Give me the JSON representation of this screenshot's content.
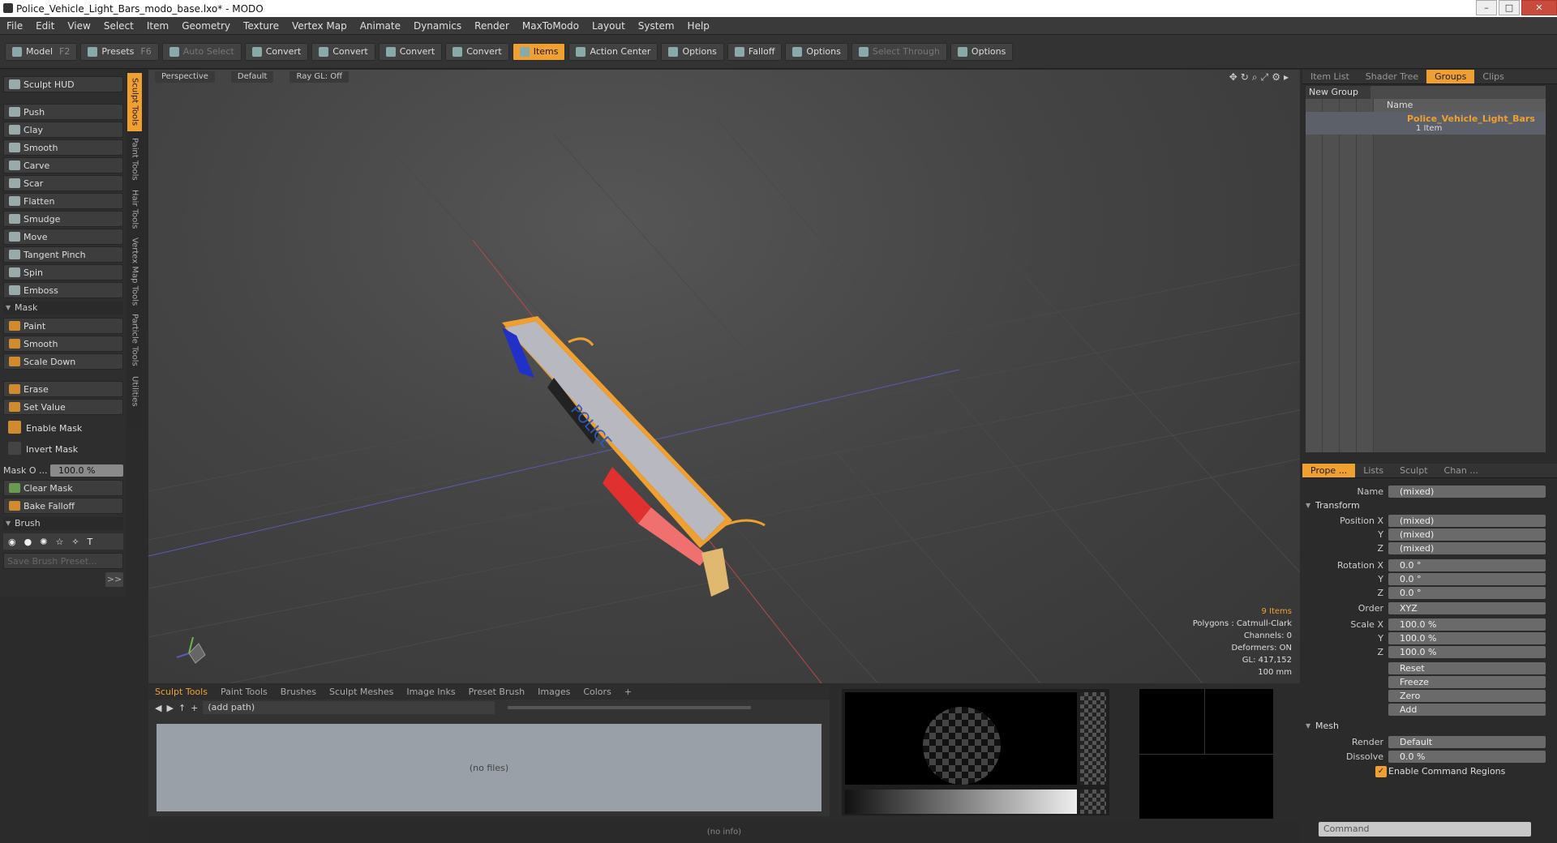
{
  "window": {
    "title": "Police_Vehicle_Light_Bars_modo_base.lxo* - MODO",
    "min": "–",
    "max": "□",
    "close": "✕"
  },
  "menu": [
    "File",
    "Edit",
    "View",
    "Select",
    "Item",
    "Geometry",
    "Texture",
    "Vertex Map",
    "Animate",
    "Dynamics",
    "Render",
    "MaxToModo",
    "Layout",
    "System",
    "Help"
  ],
  "toolbar": {
    "model": "Model",
    "model_key": "F2",
    "presets": "Presets",
    "presets_key": "F6",
    "auto_select": "Auto Select",
    "convert": "Convert",
    "items": "Items",
    "action_center": "Action Center",
    "options": "Options",
    "falloff": "Falloff",
    "select_through": "Select Through"
  },
  "left": {
    "hud": "Sculpt HUD",
    "tools": [
      "Push",
      "Clay",
      "Smooth",
      "Carve",
      "Scar",
      "Flatten",
      "Smudge",
      "Move",
      "Tangent Pinch",
      "Spin",
      "Emboss"
    ],
    "mask_section": "Mask",
    "mask_tools": [
      "Paint",
      "Smooth",
      "Scale Down"
    ],
    "erase": "Erase",
    "set_value": "Set Value",
    "enable_mask": "Enable Mask",
    "invert_mask": "Invert Mask",
    "mask_opacity_label": "Mask O ...",
    "mask_opacity": "100.0 %",
    "clear_mask": "Clear Mask",
    "bake_falloff": "Bake Falloff",
    "brush_section": "Brush",
    "save_brush_preset": "Save Brush Preset...",
    "expand": ">>"
  },
  "vtabs": [
    "Sculpt Tools",
    "Paint Tools",
    "Hair Tools",
    "Vertex Map Tools",
    "Particle Tools",
    "Utilities"
  ],
  "viewport": {
    "view": "Perspective",
    "shading": "Default",
    "raygl": "Ray GL: Off",
    "model_text": "POLICE",
    "stats": {
      "items": "9 Items",
      "polygons": "Polygons : Catmull-Clark",
      "channels": "Channels: 0",
      "deformers": "Deformers: ON",
      "gl": "GL: 417,152",
      "scale": "100 mm"
    }
  },
  "right": {
    "tabs": [
      "Item List",
      "Shader Tree",
      "Groups",
      "Clips"
    ],
    "new_group": "New Group",
    "name_col": "Name",
    "group_name": "Police_Vehicle_Light_Bars",
    "group_sub": "1 Item",
    "prop_tabs": [
      "Prope ...",
      "Lists",
      "Sculpt",
      "Chan ..."
    ],
    "name_label": "Name",
    "name_value": "(mixed)",
    "transform": "Transform",
    "position": [
      {
        "l": "Position X",
        "v": "(mixed)"
      },
      {
        "l": "Y",
        "v": "(mixed)"
      },
      {
        "l": "Z",
        "v": "(mixed)"
      }
    ],
    "rotation": [
      {
        "l": "Rotation X",
        "v": "0.0 °"
      },
      {
        "l": "Y",
        "v": "0.0 °"
      },
      {
        "l": "Z",
        "v": "0.0 °"
      }
    ],
    "order_label": "Order",
    "order": "XYZ",
    "scale": [
      {
        "l": "Scale X",
        "v": "100.0 %"
      },
      {
        "l": "Y",
        "v": "100.0 %"
      },
      {
        "l": "Z",
        "v": "100.0 %"
      }
    ],
    "actions": [
      "Reset",
      "Freeze",
      "Zero",
      "Add"
    ],
    "mesh": "Mesh",
    "render_label": "Render",
    "render": "Default",
    "dissolve_label": "Dissolve",
    "dissolve": "0.0 %",
    "enable_cmd": "Enable Command Regions",
    "command_placeholder": "Command"
  },
  "bottom": {
    "tabs": [
      "Sculpt Tools",
      "Paint Tools",
      "Brushes",
      "Sculpt Meshes",
      "Image Inks",
      "Preset Brush",
      "Images",
      "Colors",
      "+"
    ],
    "path": "(add path)",
    "nofiles": "(no files)"
  },
  "status": "(no info)"
}
